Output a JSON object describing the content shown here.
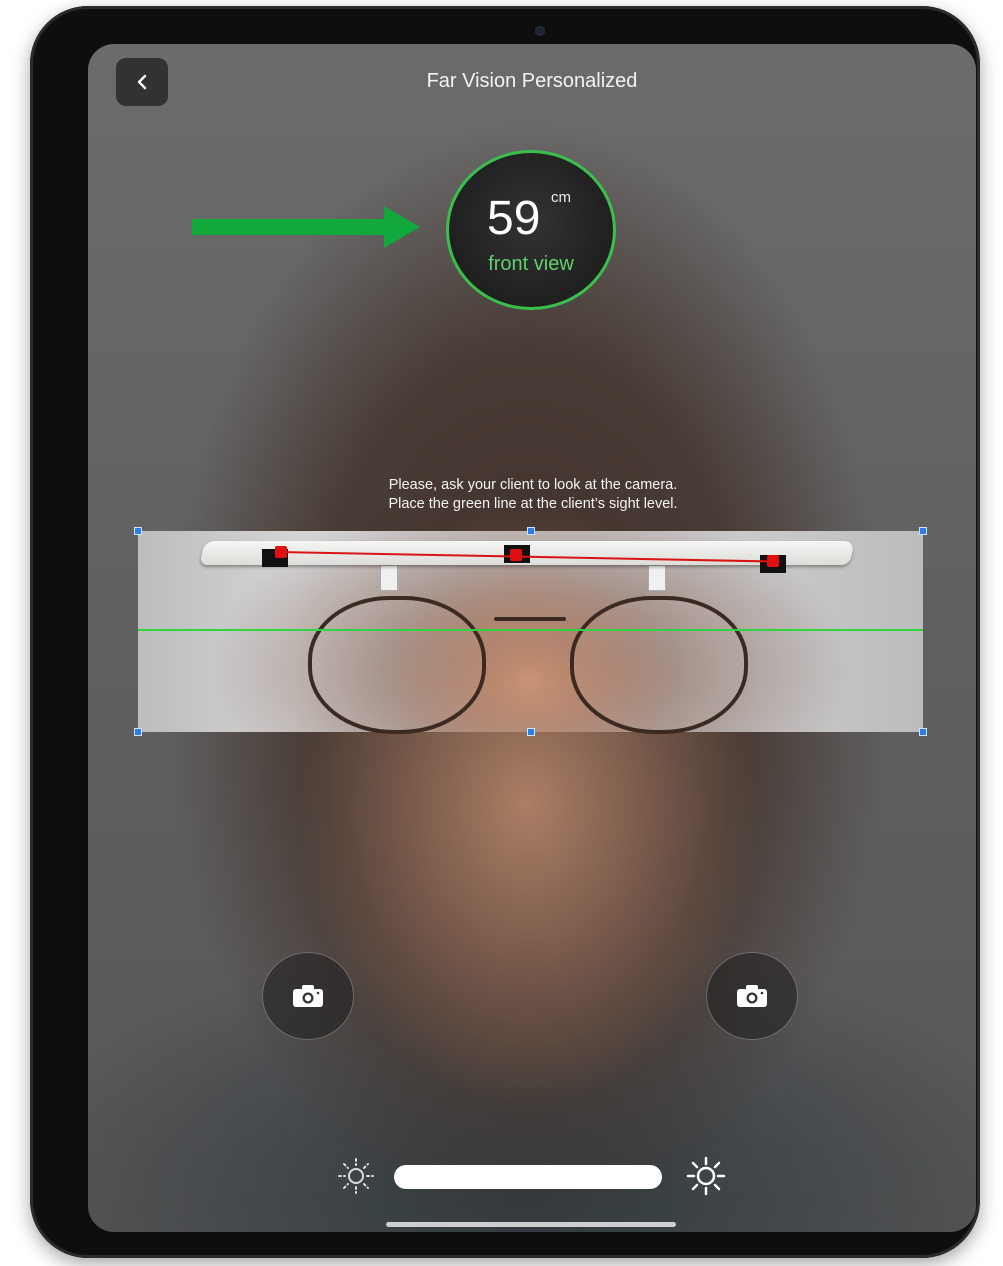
{
  "header": {
    "title": "Far Vision Personalized",
    "back_icon": "chevron-left-icon"
  },
  "distance": {
    "value": "59",
    "unit": "cm",
    "view_label": "front view",
    "ring_color": "#3bbf4c"
  },
  "annotation": {
    "arrow_color": "#11a83c",
    "arrow_icon": "right-arrow-icon"
  },
  "instructions": {
    "line1": "Please, ask your client to look at the camera.",
    "line2": "Place the green line at the client’s sight level."
  },
  "measurement": {
    "sight_line_color": "#2fd43f",
    "handle_color": "#2b7de9",
    "marker_color": "#e01010"
  },
  "controls": {
    "left_camera_icon": "camera-icon",
    "right_camera_icon": "camera-icon",
    "brightness_low_icon": "sun-low-icon",
    "brightness_high_icon": "sun-high-icon"
  }
}
